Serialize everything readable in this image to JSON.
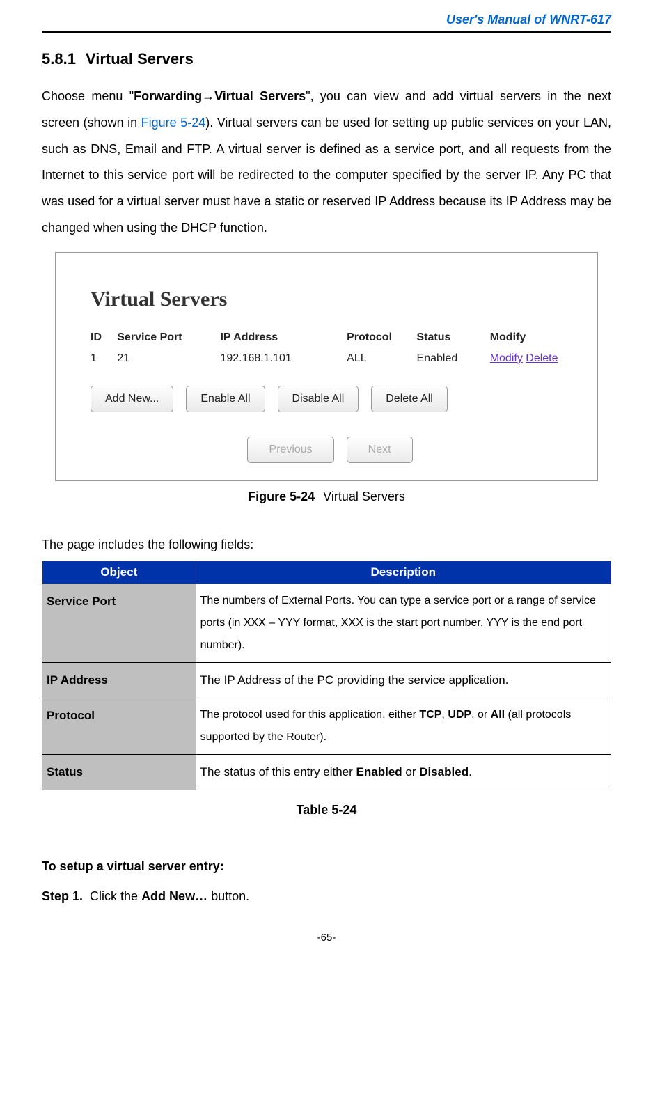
{
  "header": {
    "title": "User's Manual of WNRT-617"
  },
  "section": {
    "number": "5.8.1",
    "title": "Virtual Servers"
  },
  "intro": {
    "prefix": "Choose menu \"",
    "bold1": "Forwarding→Virtual Servers",
    "mid1": "\", you can view and add virtual servers in the next screen (shown in ",
    "figlink": "Figure 5-24",
    "rest": "). Virtual servers can be used for setting up public services on your LAN, such as DNS, Email and FTP. A virtual server is defined as a service port, and all requests from the Internet to this service port will be redirected to the computer specified by the server IP. Any PC that was used for a virtual server must have a static or reserved IP Address because its IP Address may be changed when using the DHCP function."
  },
  "figure": {
    "title": "Virtual Servers",
    "headers": {
      "id": "ID",
      "service_port": "Service Port",
      "ip": "IP Address",
      "protocol": "Protocol",
      "status": "Status",
      "modify": "Modify"
    },
    "row": {
      "id": "1",
      "service_port": "21",
      "ip": "192.168.1.101",
      "protocol": "ALL",
      "status": "Enabled",
      "modify": "Modify",
      "delete": "Delete"
    },
    "buttons": {
      "add": "Add New...",
      "enable": "Enable All",
      "disable": "Disable All",
      "delete": "Delete All",
      "prev": "Previous",
      "next": "Next"
    },
    "caption_bold": "Figure 5-24",
    "caption_text": "Virtual Servers"
  },
  "fields_intro": "The page includes the following fields:",
  "table": {
    "h1": "Object",
    "h2": "Description",
    "rows": [
      {
        "obj": "Service Port",
        "desc": "The numbers of External Ports. You can type a service port or a range of service ports (in XXX – YYY format, XXX is the start port number, YYY is the end port number)."
      },
      {
        "obj": "IP Address",
        "desc": "The IP Address of the PC providing the service application."
      },
      {
        "obj": "Protocol",
        "desc_pre": "The protocol used for this application, either ",
        "b1": "TCP",
        "sep1": ", ",
        "b2": "UDP",
        "sep2": ", or ",
        "b3": "All",
        "desc_post": " (all protocols supported by the Router)."
      },
      {
        "obj": "Status",
        "desc_pre": "The status of this entry either ",
        "b1": "Enabled",
        "sep1": " or ",
        "b2": "Disabled",
        "desc_post": "."
      }
    ],
    "caption": "Table 5-24"
  },
  "setup": {
    "heading": "To setup a virtual server entry:",
    "step_label": "Step 1.",
    "step_pre": "Click the ",
    "step_bold": "Add New…",
    "step_post": " button."
  },
  "page_number": "-65-"
}
